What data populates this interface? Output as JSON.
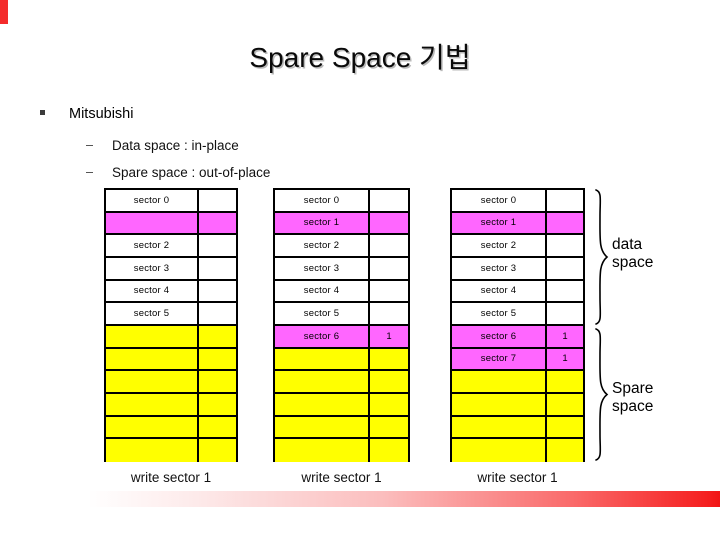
{
  "slide": {
    "title": "Spare Space 기법",
    "accent_red": "#f42b2b",
    "magenta": "#ff66ff",
    "yellow": "#ffff00"
  },
  "bullets": {
    "level1": "Mitsubishi",
    "data_space": "Data space : in-place",
    "spare_space": "Spare space : out-of-place"
  },
  "group_labels": {
    "data": "data\nspace",
    "data_line1": "data",
    "data_line2": "space",
    "spare_line1": "Spare",
    "spare_line2": "space"
  },
  "captions": {
    "t1": "write sector 1",
    "t2": "write sector 1",
    "t3": "write sector 1"
  },
  "tables": [
    {
      "id": "table-1",
      "rows": [
        {
          "label": "sector 0",
          "side": "",
          "fill": "white"
        },
        {
          "label": "",
          "side": "",
          "fill": "magenta"
        },
        {
          "label": "sector 2",
          "side": "",
          "fill": "white"
        },
        {
          "label": "sector 3",
          "side": "",
          "fill": "white"
        },
        {
          "label": "sector 4",
          "side": "",
          "fill": "white"
        },
        {
          "label": "sector 5",
          "side": "",
          "fill": "white"
        },
        {
          "label": "",
          "side": "",
          "fill": "yellow"
        },
        {
          "label": "",
          "side": "",
          "fill": "yellow"
        },
        {
          "label": "",
          "side": "",
          "fill": "yellow"
        },
        {
          "label": "",
          "side": "",
          "fill": "yellow"
        },
        {
          "label": "",
          "side": "",
          "fill": "yellow"
        },
        {
          "label": "",
          "side": "",
          "fill": "yellow"
        }
      ]
    },
    {
      "id": "table-2",
      "rows": [
        {
          "label": "sector 0",
          "side": "",
          "fill": "white"
        },
        {
          "label": "sector 1",
          "side": "",
          "fill": "magenta"
        },
        {
          "label": "sector 2",
          "side": "",
          "fill": "white"
        },
        {
          "label": "sector 3",
          "side": "",
          "fill": "white"
        },
        {
          "label": "sector 4",
          "side": "",
          "fill": "white"
        },
        {
          "label": "sector 5",
          "side": "",
          "fill": "white"
        },
        {
          "label": "sector 6",
          "side": "1",
          "fill": "magenta"
        },
        {
          "label": "",
          "side": "",
          "fill": "yellow"
        },
        {
          "label": "",
          "side": "",
          "fill": "yellow"
        },
        {
          "label": "",
          "side": "",
          "fill": "yellow"
        },
        {
          "label": "",
          "side": "",
          "fill": "yellow"
        },
        {
          "label": "",
          "side": "",
          "fill": "yellow"
        }
      ]
    },
    {
      "id": "table-3",
      "rows": [
        {
          "label": "sector 0",
          "side": "",
          "fill": "white"
        },
        {
          "label": "sector 1",
          "side": "",
          "fill": "magenta"
        },
        {
          "label": "sector 2",
          "side": "",
          "fill": "white"
        },
        {
          "label": "sector 3",
          "side": "",
          "fill": "white"
        },
        {
          "label": "sector 4",
          "side": "",
          "fill": "white"
        },
        {
          "label": "sector 5",
          "side": "",
          "fill": "white"
        },
        {
          "label": "sector 6",
          "side": "1",
          "fill": "magenta"
        },
        {
          "label": "sector 7",
          "side": "1",
          "fill": "magenta"
        },
        {
          "label": "",
          "side": "",
          "fill": "yellow"
        },
        {
          "label": "",
          "side": "",
          "fill": "yellow"
        },
        {
          "label": "",
          "side": "",
          "fill": "yellow"
        },
        {
          "label": "",
          "side": "",
          "fill": "yellow"
        }
      ]
    }
  ]
}
